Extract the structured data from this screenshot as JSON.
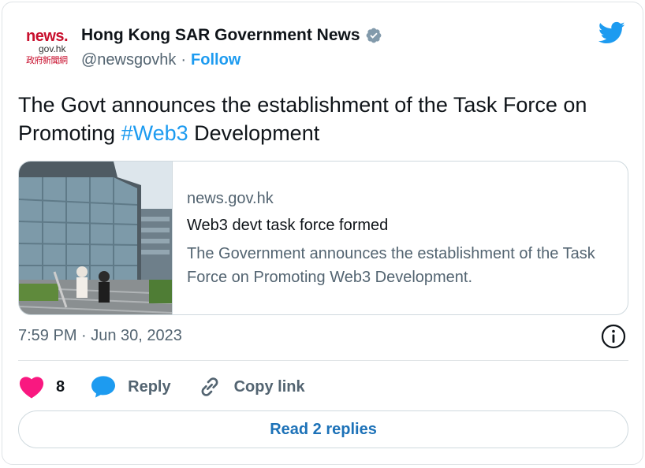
{
  "author": {
    "avatar_text": {
      "line1": "news.",
      "line2": "gov.hk",
      "line3": "政府新聞網"
    },
    "name": "Hong Kong SAR Government News",
    "handle": "@newsgovhk",
    "separator": "·",
    "follow_label": "Follow"
  },
  "icons": {
    "verified": "verified-badge-icon",
    "twitter": "twitter-bird-icon",
    "info": "info-icon",
    "like": "heart-icon",
    "reply": "speech-bubble-icon",
    "copy": "link-icon"
  },
  "tweet": {
    "text_before": "The Govt announces the establishment of the Task Force on Promoting ",
    "hashtag": "#Web3",
    "text_after": " Development"
  },
  "card": {
    "domain": "news.gov.hk",
    "title": "Web3 devt task force formed",
    "description": "The Government announces the establishment of the Task Force on Promoting Web3 Development."
  },
  "timestamp": "7:59 PM · Jun 30, 2023",
  "actions": {
    "like_count": "8",
    "reply_label": "Reply",
    "copy_label": "Copy link"
  },
  "replies_button": "Read 2 replies",
  "colors": {
    "accent": "#1d9bf0",
    "like": "#f91880",
    "text": "#0f1419",
    "secondary": "#536471"
  }
}
